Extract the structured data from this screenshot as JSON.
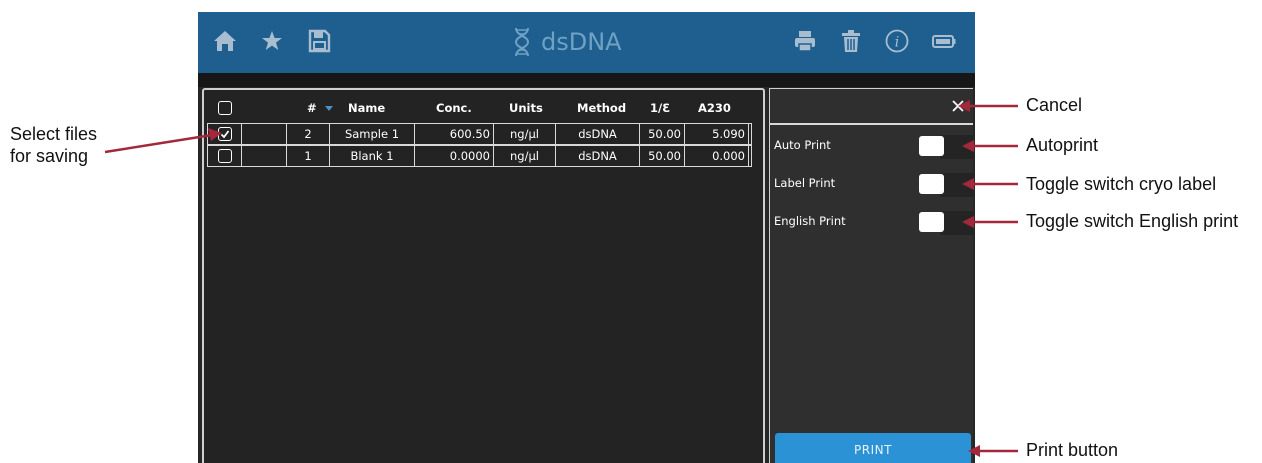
{
  "app": {
    "title": "dsDNA",
    "brand_color": "#1f5f8f",
    "title_color": "#6fa1c4",
    "toolbar_left": [
      "home-icon",
      "star-icon",
      "save-icon"
    ],
    "toolbar_right": [
      "printer-icon",
      "trash-icon",
      "info-icon",
      "battery-icon"
    ]
  },
  "table": {
    "columns": [
      "#",
      "Name",
      "Conc.",
      "Units",
      "Method",
      "1/Ɛ",
      "A230"
    ],
    "rows": [
      {
        "checked": true,
        "num": "2",
        "name": "Sample 1",
        "conc": "600.50",
        "units": "ng/µl",
        "method": "dsDNA",
        "inv_e": "50.00",
        "a230": "5.090"
      },
      {
        "checked": false,
        "num": "1",
        "name": "Blank 1",
        "conc": "0.0000",
        "units": "ng/µl",
        "method": "dsDNA",
        "inv_e": "50.00",
        "a230": "0.000"
      }
    ]
  },
  "print_panel": {
    "options": [
      {
        "label": "Auto Print",
        "enabled": false
      },
      {
        "label": "Label Print",
        "enabled": false
      },
      {
        "label": "English Print",
        "enabled": false
      }
    ],
    "print_label": "PRINT",
    "button_color": "#2b92d6"
  },
  "annotations": {
    "select_files": [
      "Select files",
      "for saving"
    ],
    "cancel": "Cancel",
    "autoprint": "Autoprint",
    "label_print": "Toggle switch cryo label",
    "english_print": "Toggle switch English print",
    "print_button": "Print button",
    "arrow_color": "#a3283b"
  }
}
